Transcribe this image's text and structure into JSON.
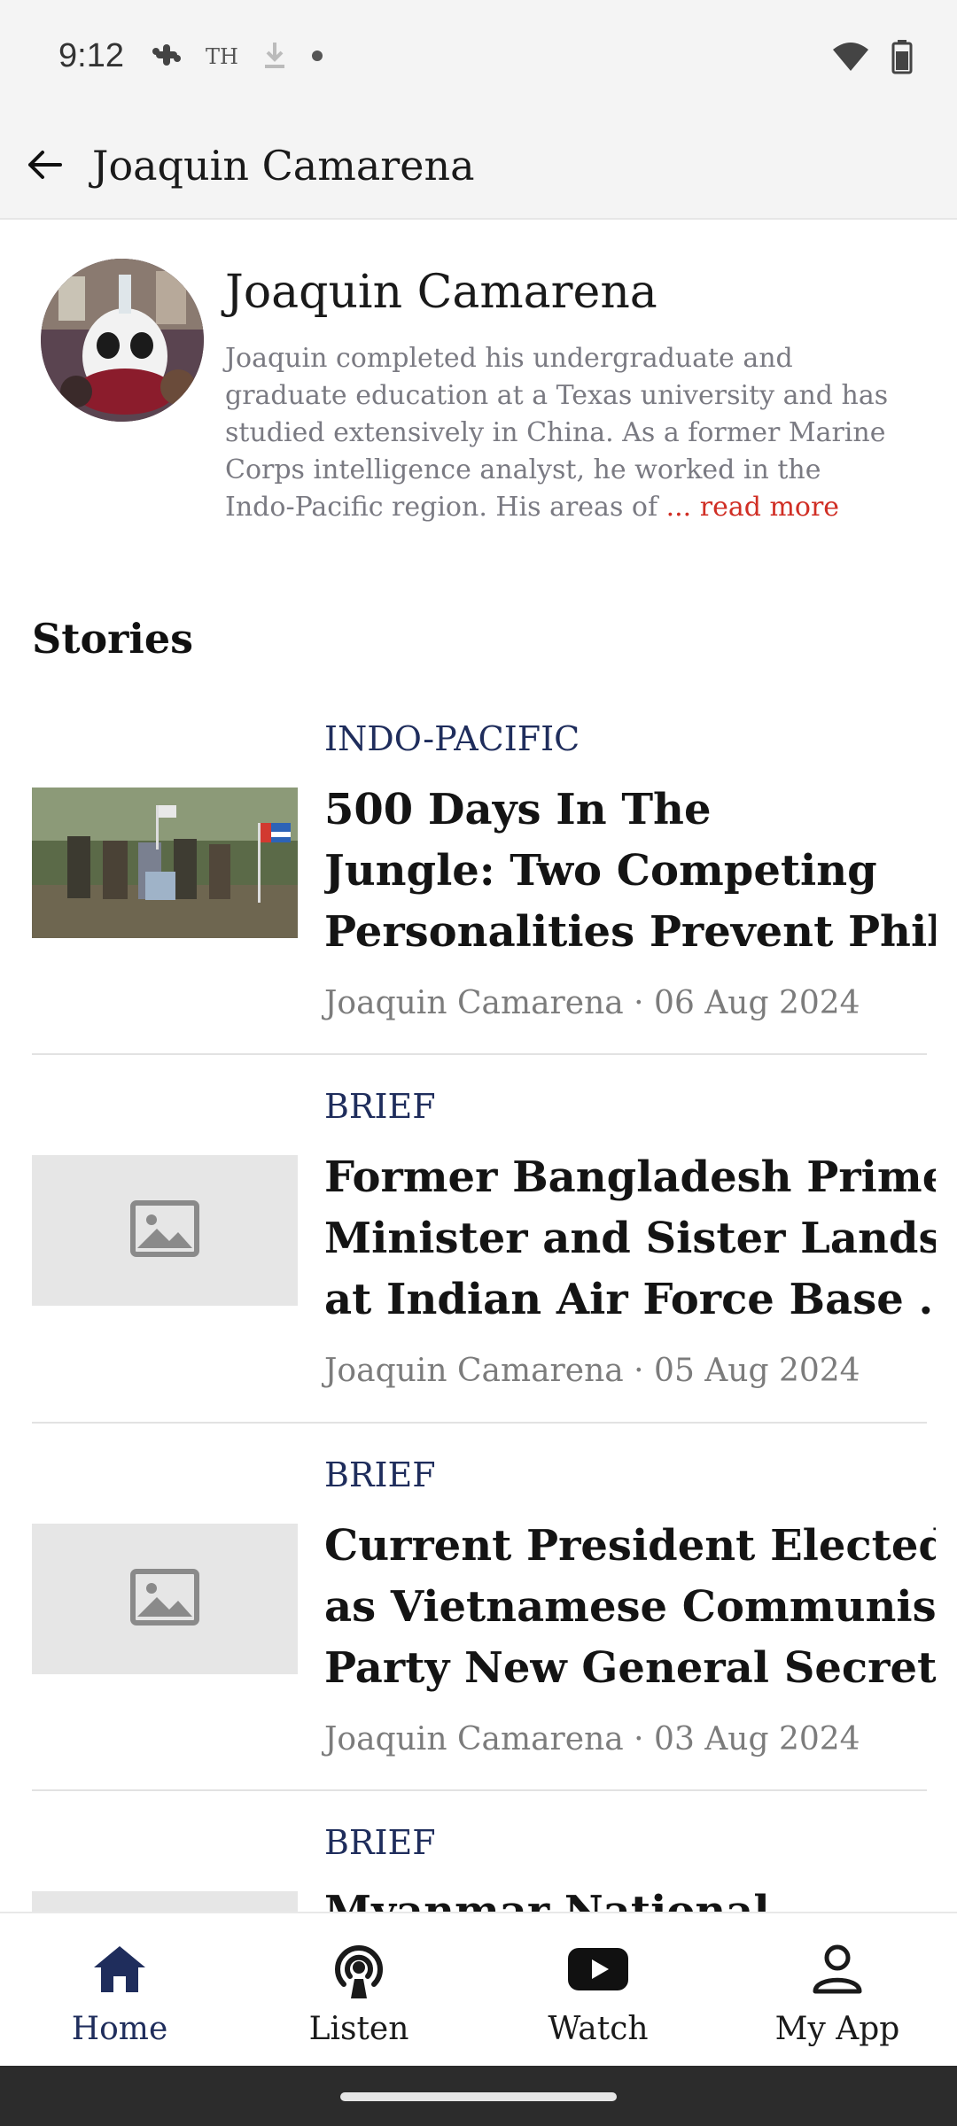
{
  "status_bar": {
    "time": "9:12",
    "left_icons": [
      "slack-icon",
      "th-icon",
      "download-icon",
      "dot-icon"
    ],
    "th_text": "TH",
    "right_icons": [
      "wifi-icon",
      "battery-icon"
    ]
  },
  "app_bar": {
    "title": "Joaquin Camarena",
    "back_icon": "back-arrow-icon"
  },
  "profile": {
    "name": "Joaquin Camarena",
    "bio": "Joaquin completed his undergraduate and graduate education at a Texas university and has studied extensively in China. As a former Marine Corps intelligence analyst, he worked in the Indo-Pacific region. His areas of",
    "read_more": "... read more"
  },
  "section_title": "Stories",
  "stories": [
    {
      "category": "INDO-PACIFIC",
      "title_lines": [
        "500 Days In The",
        "Jungle: Two Competing",
        "Personalities Prevent Phili.."
      ],
      "meta": "Joaquin Camarena · 06 Aug 2024",
      "thumbnail": "photo"
    },
    {
      "category": "BRIEF",
      "title_lines": [
        "Former Bangladesh Prime",
        "Minister and Sister Lands",
        "at Indian Air Force Base ..."
      ],
      "meta": "Joaquin Camarena · 05 Aug 2024",
      "thumbnail": "placeholder-image-icon"
    },
    {
      "category": "BRIEF",
      "title_lines": [
        "Current President Elected",
        "as Vietnamese Communist",
        "Party New General Secret..."
      ],
      "meta": "Joaquin Camarena · 03 Aug 2024",
      "thumbnail": "placeholder-image-icon"
    },
    {
      "category": "BRIEF",
      "title_lines": [
        "Myanmar National"
      ],
      "meta": "",
      "thumbnail": "placeholder-image-icon"
    }
  ],
  "bottom_nav": [
    {
      "label": "Home",
      "icon": "home-icon",
      "active": true
    },
    {
      "label": "Listen",
      "icon": "podcast-icon",
      "active": false
    },
    {
      "label": "Watch",
      "icon": "play-icon",
      "active": false
    },
    {
      "label": "My App",
      "icon": "person-icon",
      "active": false
    }
  ],
  "colors": {
    "accent": "#1f2d5c",
    "read_more": "#d02e24",
    "status_bg": "#f4f4f4"
  }
}
